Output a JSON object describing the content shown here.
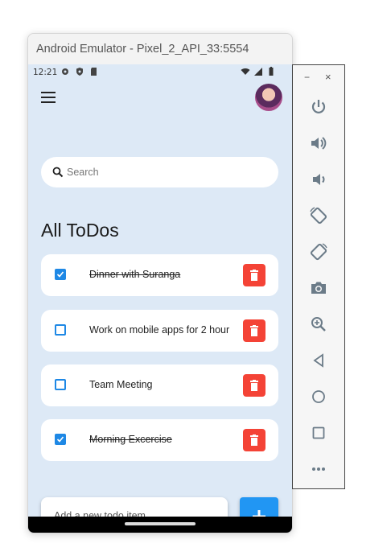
{
  "emulator": {
    "window_title": "Android Emulator - Pixel_2_API_33:5554"
  },
  "statusbar": {
    "time": "12:21",
    "left_icons": [
      "gear-icon",
      "shield-icon",
      "sd-card-icon"
    ],
    "right_icons": [
      "wifi-icon",
      "signal-icon",
      "battery-icon"
    ]
  },
  "appbar": {
    "menu_icon": "hamburger-menu-icon",
    "avatar": "user-avatar"
  },
  "search": {
    "placeholder": "Search"
  },
  "main": {
    "heading": "All ToDos",
    "todos": [
      {
        "text": "Dinner with Suranga",
        "done": true
      },
      {
        "text": "Work on mobile apps for 2 hour",
        "done": false
      },
      {
        "text": "Team Meeting",
        "done": false
      },
      {
        "text": "Morning Excercise",
        "done": true
      }
    ]
  },
  "add": {
    "placeholder": "Add a new todo item",
    "button": "+"
  },
  "sidebar": {
    "minimize": "−",
    "close": "×",
    "buttons": [
      "power-icon",
      "volume-up-icon",
      "volume-down-icon",
      "rotate-left-icon",
      "rotate-right-icon",
      "camera-icon",
      "zoom-icon",
      "back-icon",
      "home-icon",
      "overview-icon",
      "more-icon"
    ]
  },
  "colors": {
    "background": "#dde9f6",
    "checkbox": "#1e88e5",
    "delete": "#f44336",
    "add_button": "#2196f3"
  }
}
